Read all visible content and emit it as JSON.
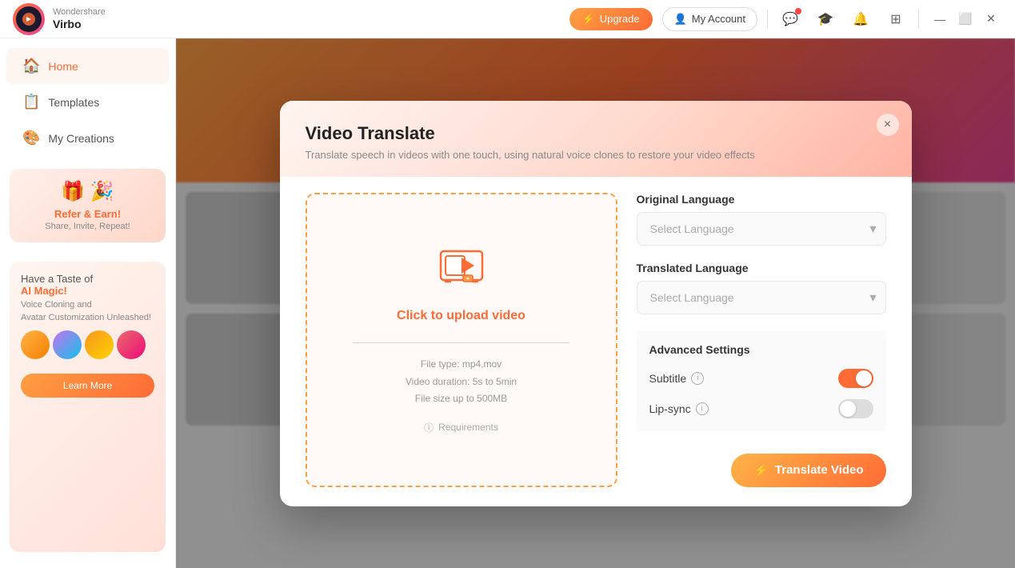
{
  "app": {
    "name_top": "Wondershare",
    "name_bottom": "Virbo"
  },
  "titlebar": {
    "upgrade_label": "Upgrade",
    "account_label": "My Account",
    "icons": [
      "chat-icon",
      "gift-icon",
      "help-icon",
      "grid-icon"
    ]
  },
  "sidebar": {
    "items": [
      {
        "id": "home",
        "label": "Home",
        "icon": "🏠",
        "active": true
      },
      {
        "id": "templates",
        "label": "Templates",
        "icon": "📋",
        "active": false
      },
      {
        "id": "my-creations",
        "label": "My Creations",
        "icon": "🎨",
        "active": false
      }
    ],
    "promo": {
      "icon": "🎁",
      "title": "Refer & Earn!",
      "subtitle": "Share, Invite, Repeat!"
    },
    "ad": {
      "title": "Have a Taste of",
      "title_orange": "AI Magic!",
      "sub1": "Voice Cloning and",
      "sub2": "Avatar Customization Unleashed!",
      "learn_more": "Learn More"
    }
  },
  "modal": {
    "title": "Video Translate",
    "subtitle": "Translate speech in videos with one touch, using natural voice clones to restore your video effects",
    "close_label": "×",
    "upload": {
      "label": "Click to upload video",
      "file_type": "File type: mp4,mov",
      "duration": "Video duration: 5s to 5min",
      "size": "File size up to  500MB",
      "requirements": "Requirements"
    },
    "original_language": {
      "label": "Original Language",
      "placeholder": "Select Language"
    },
    "translated_language": {
      "label": "Translated Language",
      "placeholder": "Select Language"
    },
    "advanced": {
      "title": "Advanced Settings",
      "subtitle_label": "Subtitle",
      "subtitle_on": true,
      "lipsync_label": "Lip-sync",
      "lipsync_on": false
    },
    "translate_btn": "Translate Video"
  }
}
